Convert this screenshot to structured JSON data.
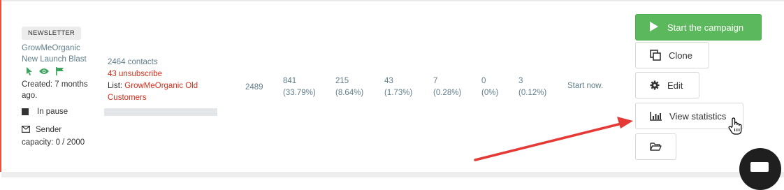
{
  "campaign": {
    "type_badge": "NEWSLETTER",
    "name_line1": "GrowMeOrganic",
    "name_line2": "New Launch Blast",
    "created": "Created: 7 months ago.",
    "status": "In pause",
    "sender_label": "Sender",
    "sender_capacity": "capacity: 0 / 2000"
  },
  "contacts": {
    "count": "2464 contacts",
    "unsubscribe": "43 unsubscribe",
    "list_label": "List:",
    "list_name": "GrowMeOrganic Old Customers"
  },
  "stats": {
    "total": "2489",
    "opened": "841",
    "opened_pct": "(33.79%)",
    "clicked": "215",
    "clicked_pct": "(8.64%)",
    "unsubscribed": "43",
    "unsubscribed_pct": "(1.73%)",
    "bounced": "7",
    "bounced_pct": "(0.28%)",
    "complaints": "0",
    "complaints_pct": "(0%)",
    "errors": "3",
    "errors_pct": "(0.12%)",
    "next_send": "Start now."
  },
  "actions": {
    "start": "Start the campaign",
    "clone": "Clone",
    "edit": "Edit",
    "view_stats": "View statistics"
  },
  "colors": {
    "accent_green": "#5cb85c",
    "danger_red": "#d32f1c",
    "muted_text": "#607d8b",
    "annotation_arrow": "#e53935"
  },
  "icons": [
    "cursor-icon",
    "eye-icon",
    "flag-icon",
    "square-icon",
    "envelope-icon",
    "play-icon",
    "clone-icon",
    "gear-icon",
    "bar-chart-icon",
    "folder-icon",
    "hand-pointer-icon",
    "chat-icon"
  ]
}
